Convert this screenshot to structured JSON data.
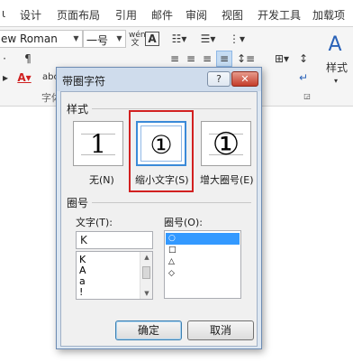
{
  "ribbon": {
    "tabs": [
      "设计",
      "页面布局",
      "引用",
      "邮件",
      "审阅",
      "视图",
      "开发工具",
      "加载项"
    ],
    "font_name": "ew Roman",
    "font_size": "一号",
    "style_label": "样式",
    "font_group_label": "字体",
    "colors": {
      "font_color": "#d02020",
      "tab_bg": "#ffffff",
      "ribbon_bg": "#f5f5f5"
    },
    "icons": [
      "phonetic-guide-icon",
      "char-border-icon",
      "bullets-icon",
      "numbering-icon",
      "multilevel-list-icon",
      "align-left-icon",
      "align-center-icon",
      "align-right-icon",
      "justify-icon",
      "line-spacing-icon",
      "font-color-icon",
      "strikethrough-icon",
      "subscript-icon",
      "superscript-icon",
      "sort-icon",
      "paragraph-mark-icon"
    ]
  },
  "dialog": {
    "title": "带圈字符",
    "help_label": "?",
    "close_label": "✕",
    "style_group_label": "样式",
    "styles": [
      {
        "glyph": "1",
        "caption": "无(N)"
      },
      {
        "glyph": "①",
        "caption": "缩小文字(S)"
      },
      {
        "glyph": "①",
        "caption": "增大圈号(E)"
      }
    ],
    "selected_style": "缩小文字(S)",
    "enclosure_group_label": "圈号",
    "text_label": "文字(T):",
    "text_value": "K",
    "text_list": [
      "K",
      "A",
      "a",
      "!"
    ],
    "enclosure_label": "圈号(O):",
    "enclosures": [
      "○",
      "□",
      "△",
      "◇"
    ],
    "selected_enclosure": "○",
    "ok_label": "确定",
    "cancel_label": "取消",
    "highlight_color": "#d22020",
    "selection_color": "#3399ff"
  }
}
